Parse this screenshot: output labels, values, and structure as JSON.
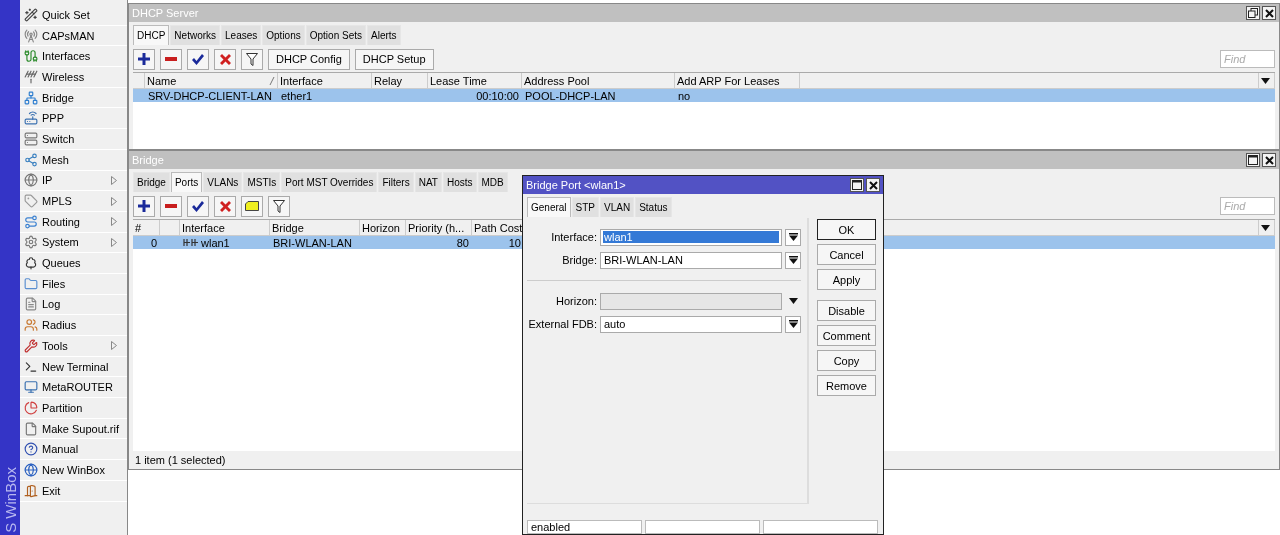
{
  "sidebar": {
    "brand": "S WinBox",
    "items": [
      {
        "label": "Quick Set",
        "has_submenu": false
      },
      {
        "label": "CAPsMAN",
        "has_submenu": false
      },
      {
        "label": "Interfaces",
        "has_submenu": false
      },
      {
        "label": "Wireless",
        "has_submenu": false
      },
      {
        "label": "Bridge",
        "has_submenu": false
      },
      {
        "label": "PPP",
        "has_submenu": false
      },
      {
        "label": "Switch",
        "has_submenu": false
      },
      {
        "label": "Mesh",
        "has_submenu": false
      },
      {
        "label": "IP",
        "has_submenu": true
      },
      {
        "label": "MPLS",
        "has_submenu": true
      },
      {
        "label": "Routing",
        "has_submenu": true
      },
      {
        "label": "System",
        "has_submenu": true
      },
      {
        "label": "Queues",
        "has_submenu": false
      },
      {
        "label": "Files",
        "has_submenu": false
      },
      {
        "label": "Log",
        "has_submenu": false
      },
      {
        "label": "Radius",
        "has_submenu": false
      },
      {
        "label": "Tools",
        "has_submenu": true
      },
      {
        "label": "New Terminal",
        "has_submenu": false
      },
      {
        "label": "MetaROUTER",
        "has_submenu": false
      },
      {
        "label": "Partition",
        "has_submenu": false
      },
      {
        "label": "Make Supout.rif",
        "has_submenu": false
      },
      {
        "label": "Manual",
        "has_submenu": false
      },
      {
        "label": "New WinBox",
        "has_submenu": false
      },
      {
        "label": "Exit",
        "has_submenu": false
      }
    ]
  },
  "dhcp_window": {
    "title": "DHCP Server",
    "tabs": [
      {
        "label": "DHCP",
        "selected": true
      },
      {
        "label": "Networks",
        "selected": false
      },
      {
        "label": "Leases",
        "selected": false
      },
      {
        "label": "Options",
        "selected": false
      },
      {
        "label": "Option Sets",
        "selected": false
      },
      {
        "label": "Alerts",
        "selected": false
      }
    ],
    "toolbar": [
      {
        "kind": "add"
      },
      {
        "kind": "remove"
      },
      {
        "kind": "enable"
      },
      {
        "kind": "disable"
      },
      {
        "kind": "filter"
      },
      {
        "kind": "text",
        "label": "DHCP Config"
      },
      {
        "kind": "text",
        "label": "DHCP Setup"
      }
    ],
    "find": {
      "placeholder": "Find"
    },
    "table": {
      "columns": [
        {
          "label": "Name",
          "sorted": true,
          "numeric": false
        },
        {
          "label": "Interface",
          "sorted": false,
          "numeric": false
        },
        {
          "label": "Relay",
          "sorted": false,
          "numeric": false
        },
        {
          "label": "Lease Time",
          "sorted": false,
          "numeric": true
        },
        {
          "label": "Address Pool",
          "sorted": false,
          "numeric": false
        },
        {
          "label": "Add ARP For Leases",
          "sorted": false,
          "numeric": false
        }
      ],
      "rows": [
        {
          "selected": true,
          "cells": [
            "SRV-DHCP-CLIENT-LAN",
            "ether1",
            null,
            "00:10:00",
            "POOL-DHCP-LAN",
            "no"
          ]
        }
      ]
    }
  },
  "bridge_window": {
    "title": "Bridge",
    "tabs": [
      {
        "label": "Bridge",
        "selected": false
      },
      {
        "label": "Ports",
        "selected": true
      },
      {
        "label": "VLANs",
        "selected": false
      },
      {
        "label": "MSTIs",
        "selected": false
      },
      {
        "label": "Port MST Overrides",
        "selected": false
      },
      {
        "label": "Filters",
        "selected": false
      },
      {
        "label": "NAT",
        "selected": false
      },
      {
        "label": "Hosts",
        "selected": false
      },
      {
        "label": "MDB",
        "selected": false
      }
    ],
    "toolbar": [
      {
        "kind": "add"
      },
      {
        "kind": "remove"
      },
      {
        "kind": "enable"
      },
      {
        "kind": "disable"
      },
      {
        "kind": "comment"
      },
      {
        "kind": "filter"
      }
    ],
    "find": {
      "placeholder": "Find"
    },
    "table": {
      "columns": [
        {
          "label": "#",
          "numeric": true
        },
        {
          "label": "Interface",
          "numeric": false
        },
        {
          "label": "Bridge",
          "numeric": false
        },
        {
          "label": "Horizon",
          "numeric": false
        },
        {
          "label": "Priority (h...",
          "numeric": true
        },
        {
          "label": "Path Cost",
          "numeric": true
        }
      ],
      "rows": [
        {
          "selected": true,
          "cells": [
            "0",
            "wlan1",
            "BRI-WLAN-LAN",
            null,
            "80",
            "10"
          ]
        }
      ]
    },
    "status": "1 item (1 selected)"
  },
  "bridge_port_dialog": {
    "title": "Bridge Port <wlan1>",
    "tabs": [
      {
        "label": "General",
        "selected": true
      },
      {
        "label": "STP",
        "selected": false
      },
      {
        "label": "VLAN",
        "selected": false
      },
      {
        "label": "Status",
        "selected": false
      }
    ],
    "field_groups": [
      [
        {
          "label": "Interface:",
          "value": "wlan1",
          "kind": "dropdown",
          "highlighted": true,
          "disabled": false
        },
        {
          "label": "Bridge:",
          "value": "BRI-WLAN-LAN",
          "kind": "dropdown",
          "highlighted": false,
          "disabled": false
        }
      ],
      [
        {
          "label": "Horizon:",
          "kind": "combo",
          "disabled": true
        },
        {
          "label": "External FDB:",
          "value": "auto",
          "kind": "dropdown",
          "highlighted": false,
          "disabled": false
        }
      ]
    ],
    "button_groups": [
      [
        {
          "label": "OK",
          "default": true
        },
        {
          "label": "Cancel",
          "default": false
        },
        {
          "label": "Apply",
          "default": false
        }
      ],
      [
        {
          "label": "Disable",
          "default": false
        },
        {
          "label": "Comment",
          "default": false
        },
        {
          "label": "Copy",
          "default": false
        },
        {
          "label": "Remove",
          "default": false
        }
      ]
    ],
    "status_cells": [
      "enabled",
      null,
      null
    ]
  }
}
